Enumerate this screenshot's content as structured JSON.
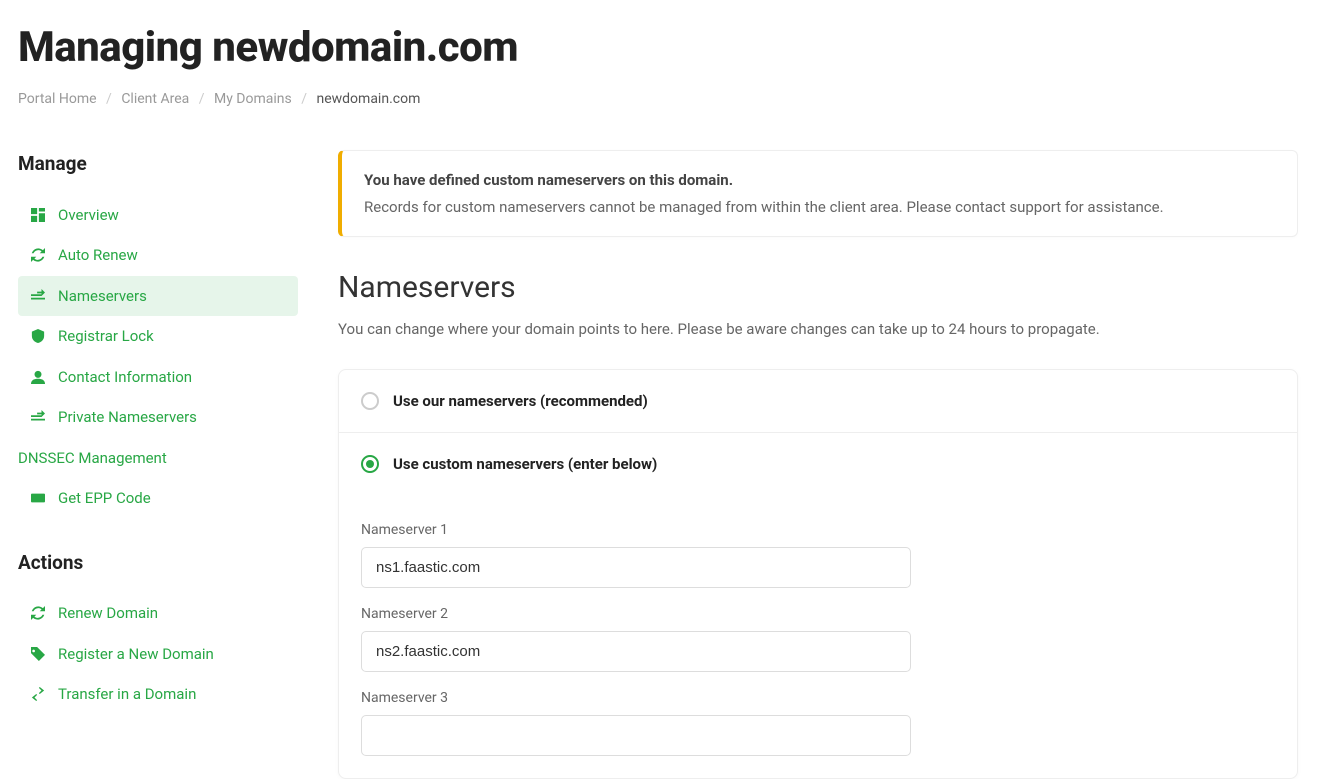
{
  "page_title": "Managing newdomain.com",
  "breadcrumb": {
    "items": [
      "Portal Home",
      "Client Area",
      "My Domains"
    ],
    "current": "newdomain.com"
  },
  "sidebar": {
    "manage_title": "Manage",
    "actions_title": "Actions",
    "manage_items": [
      {
        "label": "Overview"
      },
      {
        "label": "Auto Renew"
      },
      {
        "label": "Nameservers"
      },
      {
        "label": "Registrar Lock"
      },
      {
        "label": "Contact Information"
      },
      {
        "label": "Private Nameservers"
      },
      {
        "label": "DNSSEC Management"
      },
      {
        "label": "Get EPP Code"
      }
    ],
    "action_items": [
      {
        "label": "Renew Domain"
      },
      {
        "label": "Register a New Domain"
      },
      {
        "label": "Transfer in a Domain"
      }
    ]
  },
  "alert": {
    "title": "You have defined custom nameservers on this domain.",
    "body": "Records for custom nameservers cannot be managed from within the client area. Please contact support for assistance."
  },
  "section": {
    "title": "Nameservers",
    "subtitle": "You can change where your domain points to here. Please be aware changes can take up to 24 hours to propagate."
  },
  "options": {
    "default_label": "Use our nameservers (recommended)",
    "custom_label": "Use custom nameservers (enter below)",
    "selected": "custom"
  },
  "fields": [
    {
      "label": "Nameserver 1",
      "value": "ns1.faastic.com"
    },
    {
      "label": "Nameserver 2",
      "value": "ns2.faastic.com"
    },
    {
      "label": "Nameserver 3",
      "value": ""
    }
  ],
  "colors": {
    "accent": "#28a745",
    "warning": "#f0ad00"
  }
}
